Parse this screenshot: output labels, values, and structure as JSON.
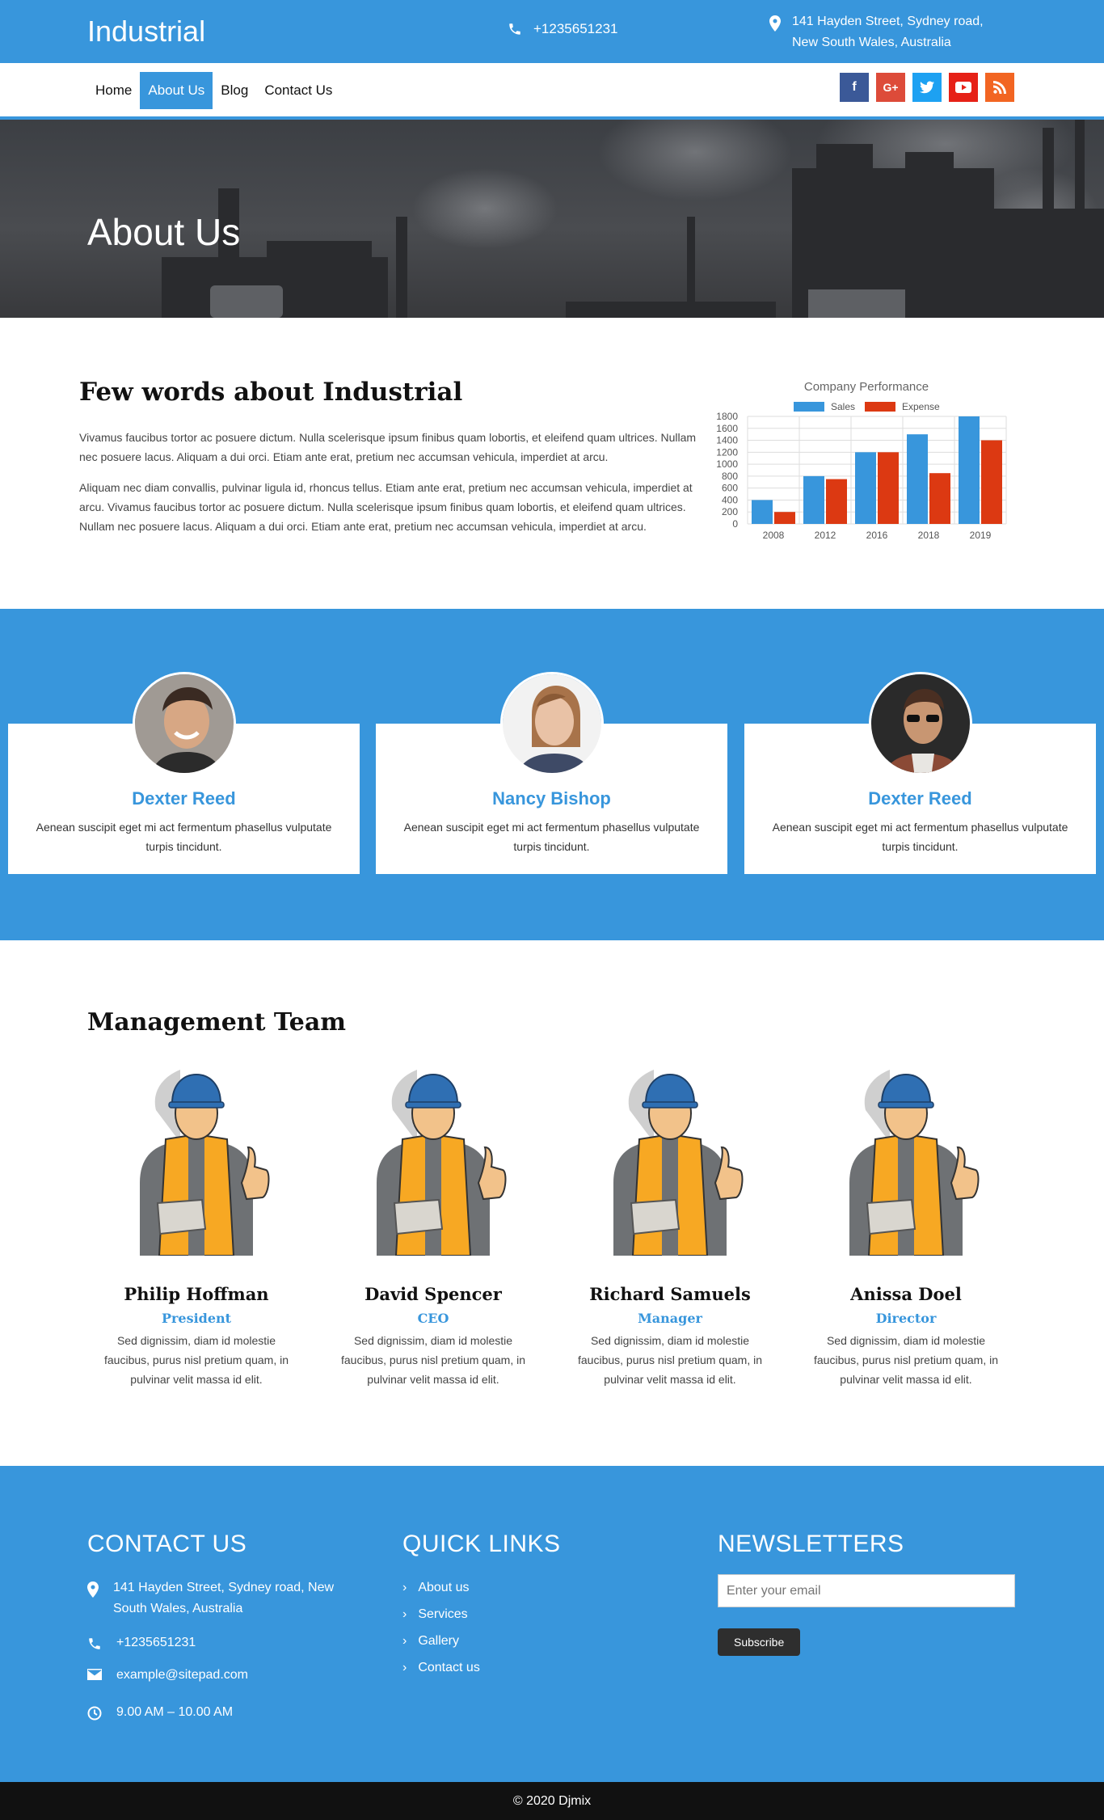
{
  "header": {
    "brand": "Industrial",
    "phone": "+1235651231",
    "address": "141 Hayden Street, Sydney road, New South Wales, Australia"
  },
  "nav": {
    "items": [
      {
        "label": "Home",
        "active": false
      },
      {
        "label": "About Us",
        "active": true
      },
      {
        "label": "Blog",
        "active": false
      },
      {
        "label": "Contact Us",
        "active": false
      }
    ],
    "social": [
      {
        "icon": "facebook-icon",
        "glyph": "f",
        "color": "#3b5998"
      },
      {
        "icon": "google-plus-icon",
        "glyph": "G+",
        "color": "#dd4b39"
      },
      {
        "icon": "twitter-icon",
        "glyph": "t",
        "color": "#1da1f2"
      },
      {
        "icon": "youtube-icon",
        "glyph": "▶",
        "color": "#e62117"
      },
      {
        "icon": "rss-icon",
        "glyph": "◉",
        "color": "#f26522"
      }
    ]
  },
  "hero": {
    "title": "About Us"
  },
  "about": {
    "heading": "Few words about Industrial",
    "paragraph1": "Vivamus faucibus tortor ac posuere dictum. Nulla scelerisque ipsum finibus quam lobortis, et eleifend quam ultrices. Nullam nec posuere lacus. Aliquam a dui orci. Etiam ante erat, pretium nec accumsan vehicula, imperdiet at arcu.",
    "paragraph2": "Aliquam nec diam convallis, pulvinar ligula id, rhoncus tellus. Etiam ante erat, pretium nec accumsan vehicula, imperdiet at arcu. Vivamus faucibus tortor ac posuere dictum. Nulla scelerisque ipsum finibus quam lobortis, et eleifend quam ultrices. Nullam nec posuere lacus. Aliquam a dui orci. Etiam ante erat, pretium nec accumsan vehicula, imperdiet at arcu."
  },
  "chart_data": {
    "type": "bar",
    "title": "Company Performance",
    "categories": [
      "2008",
      "2012",
      "2016",
      "2018",
      "2019"
    ],
    "series": [
      {
        "name": "Sales",
        "color": "#3896dc",
        "values": [
          400,
          800,
          1200,
          1500,
          1800
        ]
      },
      {
        "name": "Expense",
        "color": "#dc3912",
        "values": [
          200,
          750,
          1200,
          850,
          1400
        ]
      }
    ],
    "yticks": [
      "0",
      "200",
      "400",
      "600",
      "800",
      "1000",
      "1200",
      "1400",
      "1600",
      "1800"
    ],
    "ylim": [
      0,
      1800
    ],
    "legend": "top",
    "grid": true
  },
  "team": [
    {
      "name": "Dexter Reed",
      "desc": "Aenean suscipit eget mi act fermentum phasellus vulputate turpis tincidunt."
    },
    {
      "name": "Nancy Bishop",
      "desc": "Aenean suscipit eget mi act fermentum phasellus vulputate turpis tincidunt."
    },
    {
      "name": "Dexter Reed",
      "desc": "Aenean suscipit eget mi act fermentum phasellus vulputate turpis tincidunt."
    }
  ],
  "management": {
    "heading": "Management Team",
    "members": [
      {
        "name": "Philip Hoffman",
        "role": "President",
        "desc": "Sed dignissim, diam id molestie faucibus, purus nisl pretium quam, in pulvinar velit massa id elit."
      },
      {
        "name": "David Spencer",
        "role": "CEO",
        "desc": "Sed dignissim, diam id molestie faucibus, purus nisl pretium quam, in pulvinar velit massa id elit."
      },
      {
        "name": "Richard Samuels",
        "role": "Manager",
        "desc": "Sed dignissim, diam id molestie faucibus, purus nisl pretium quam, in pulvinar velit massa id elit."
      },
      {
        "name": "Anissa Doel",
        "role": "Director",
        "desc": "Sed dignissim, diam id molestie faucibus, purus nisl pretium quam, in pulvinar velit massa id elit."
      }
    ]
  },
  "footer": {
    "contact_heading": "CONTACT US",
    "address": "141 Hayden Street, Sydney road, New South Wales, Australia",
    "phone": "+1235651231",
    "email": "example@sitepad.com",
    "hours": "9.00 AM – 10.00 AM",
    "links_heading": "QUICK LINKS",
    "links": [
      "About us",
      "Services",
      "Gallery",
      "Contact us"
    ],
    "newsletter_heading": "NEWSLETTERS",
    "email_placeholder": "Enter your email",
    "subscribe_label": "Subscribe",
    "copyright": "© 2020 Djmix"
  }
}
